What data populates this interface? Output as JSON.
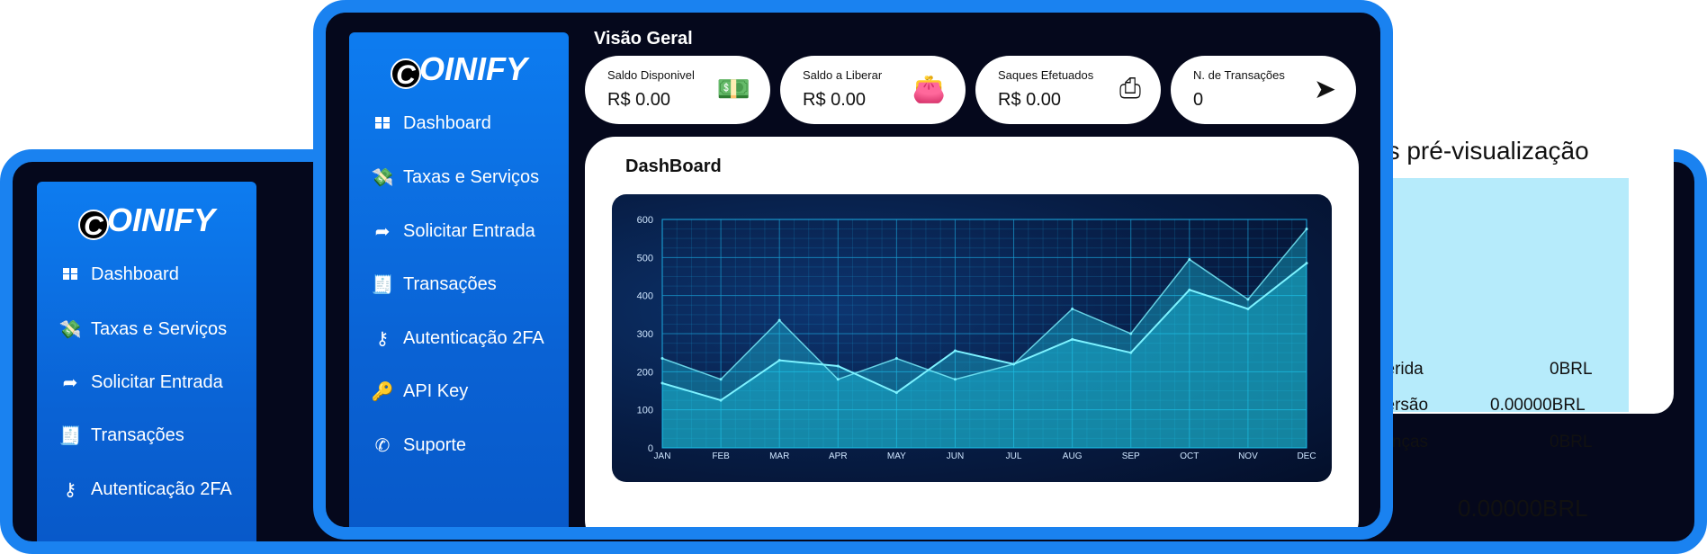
{
  "brand": {
    "logo_letter": "C",
    "logo_rest": "OINIFY"
  },
  "sidebar_back": {
    "items": [
      {
        "label": "Dashboard",
        "icon": "dashboard-grid-icon"
      },
      {
        "label": "Taxas e Serviços",
        "icon": "money-bill-icon"
      },
      {
        "label": "Solicitar Entrada",
        "icon": "share-arrow-icon"
      },
      {
        "label": "Transações",
        "icon": "receipt-icon"
      },
      {
        "label": "Autenticação 2FA",
        "icon": "keys-icon"
      }
    ]
  },
  "sidebar_front": {
    "items": [
      {
        "label": "Dashboard",
        "icon": "dashboard-grid-icon"
      },
      {
        "label": "Taxas e Serviços",
        "icon": "money-bill-icon"
      },
      {
        "label": "Solicitar Entrada",
        "icon": "share-arrow-icon"
      },
      {
        "label": "Transações",
        "icon": "receipt-icon"
      },
      {
        "label": "Autenticação 2FA",
        "icon": "keys-icon"
      },
      {
        "label": "API Key",
        "icon": "key-icon"
      },
      {
        "label": "Suporte",
        "icon": "phone-icon"
      }
    ]
  },
  "header": {
    "title": "Visão Geral"
  },
  "cards": [
    {
      "label": "Saldo Disponivel",
      "value": "R$ 0.00",
      "icon": "money-bill-icon",
      "glyph": "💵"
    },
    {
      "label": "Saldo a Liberar",
      "value": "R$ 0.00",
      "icon": "wallet-icon",
      "glyph": "👛"
    },
    {
      "label": "Saques Efetuados",
      "value": "R$ 0.00",
      "icon": "withdraw-icon",
      "glyph": "⎙"
    },
    {
      "label": "N. de Transações",
      "value": "0",
      "icon": "paper-plane-icon",
      "glyph": "➤"
    }
  ],
  "dashboard": {
    "title": "DashBoard"
  },
  "chart_data": {
    "type": "area",
    "x": [
      "JAN",
      "FEB",
      "MAR",
      "APR",
      "MAY",
      "JUN",
      "JUL",
      "AUG",
      "SEP",
      "OCT",
      "NOV",
      "DEC"
    ],
    "ylim": [
      0,
      600
    ],
    "yticks": [
      0,
      100,
      200,
      300,
      400,
      500,
      600
    ],
    "grid": true,
    "series": [
      {
        "values": [
          235,
          180,
          335,
          180,
          235,
          180,
          220,
          365,
          300,
          495,
          390,
          575
        ]
      },
      {
        "values": [
          170,
          125,
          230,
          215,
          145,
          255,
          220,
          285,
          250,
          415,
          365,
          485
        ]
      }
    ],
    "colors": {
      "area_top": "#1fd6f2",
      "line": "#7df2ff",
      "grid": "#1a9bd0"
    }
  },
  "preview": {
    "title": "os pré-visualização",
    "rows": [
      {
        "label": "serida",
        "value": "0BRL"
      },
      {
        "label": "versão",
        "value": "0.00000BRL"
      },
      {
        "label": "ranças",
        "value": "0BRL"
      }
    ],
    "total": "0.00000BRL"
  },
  "topbar": {
    "bell_icon": "bell-clock-icon",
    "avatar_icon": "user-avatar-icon"
  }
}
